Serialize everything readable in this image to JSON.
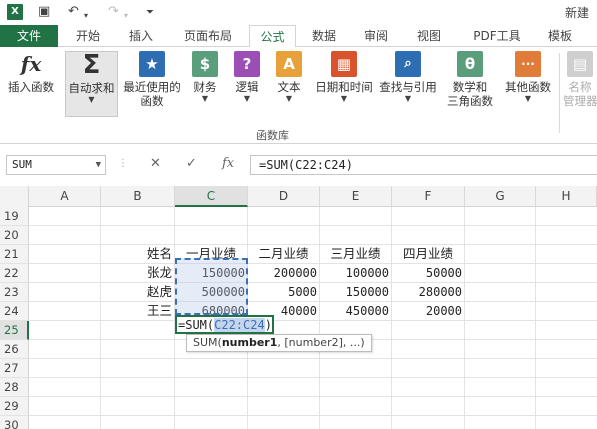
{
  "window": {
    "title": "新建"
  },
  "tabs": [
    "文件",
    "开始",
    "插入",
    "页面布局",
    "公式",
    "数据",
    "审阅",
    "视图",
    "PDF工具",
    "模板"
  ],
  "ribbon": {
    "buttons": [
      {
        "label": "插入函数",
        "icon": "fx"
      },
      {
        "label": "自动求和",
        "icon": "Σ"
      },
      {
        "label": "最近使用的",
        "label2": "函数",
        "icon": "★"
      },
      {
        "label": "财务",
        "icon": "$"
      },
      {
        "label": "逻辑",
        "icon": "?"
      },
      {
        "label": "文本",
        "icon": "A"
      },
      {
        "label": "日期和时间",
        "icon": "▦"
      },
      {
        "label": "查找与引用",
        "icon": "🔍"
      },
      {
        "label": "数学和",
        "label2": "三角函数",
        "icon": "θ"
      },
      {
        "label": "其他函数",
        "icon": "···"
      },
      {
        "label": "名称",
        "label2": "管理器",
        "icon": "▤"
      }
    ],
    "group_label": "函数库"
  },
  "formula_bar": {
    "name_box": "SUM",
    "cancel": "✕",
    "enter": "✓",
    "fx": "fx",
    "formula": "=SUM(C22:C24)"
  },
  "grid": {
    "columns": [
      "A",
      "B",
      "C",
      "D",
      "E",
      "F",
      "G",
      "H"
    ],
    "rows": [
      "19",
      "20",
      "21",
      "22",
      "23",
      "24",
      "25",
      "26",
      "27",
      "28",
      "29",
      "30"
    ],
    "header_row": [
      "姓名",
      "一月业绩",
      "二月业绩",
      "三月业绩",
      "四月业绩"
    ],
    "data": [
      {
        "name": "张龙",
        "values": [
          "150000",
          "200000",
          "100000",
          "50000"
        ]
      },
      {
        "name": "赵虎",
        "values": [
          "500000",
          "5000",
          "150000",
          "280000"
        ]
      },
      {
        "name": "王三",
        "values": [
          "680000",
          "40000",
          "450000",
          "20000"
        ]
      }
    ],
    "edit_prefix": "=SUM(",
    "edit_ref": "C22:C24",
    "edit_suffix": ")",
    "tooltip": {
      "fn": "SUM(",
      "arg1": "number1",
      "rest": ", [number2], ...)"
    }
  }
}
